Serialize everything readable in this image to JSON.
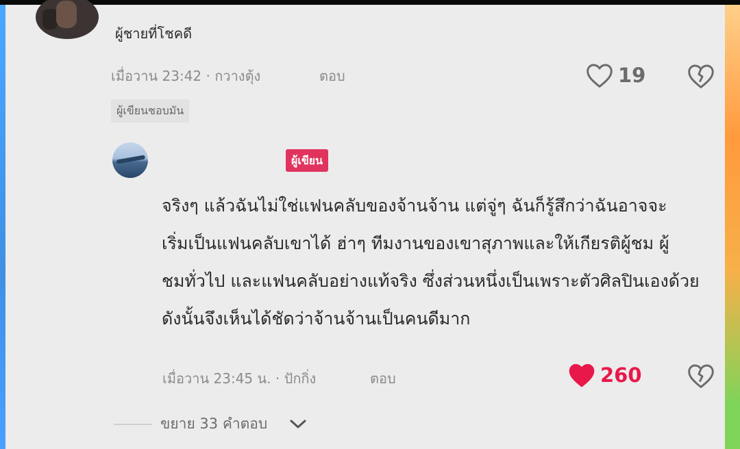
{
  "comment": {
    "username": "ผู้ชายที่โชคดี",
    "meta": "เมื่อวาน 23:42 · กวางตุ้ง",
    "reply_label": "ตอบ",
    "like_count": "19",
    "author_liked_label": "ผู้เขียนชอบมัน"
  },
  "reply": {
    "author_badge": "ผู้เขียน",
    "text_lines": [
      "จริงๆ แล้วฉันไม่ใช่แฟนคลับของจ้านจ้าน แต่จู่ๆ ฉันก็รู้สึกว่าฉันอาจจะ",
      "เริ่มเป็นแฟนคลับเขาได้ ฮ่าๆ ทีมงานของเขาสุภาพและให้เกียรติผู้ชม ผู้",
      "ชมทั่วไป และแฟนคลับอย่างแท้จริง ซึ่งส่วนหนึ่งเป็นเพราะตัวศิลปินเองด้วย",
      "ดังนั้นจึงเห็นได้ชัดว่าจ้านจ้านเป็นคนดีมาก"
    ],
    "meta": "เมื่อวาน 23:45 น. · ปักกิ่ง",
    "reply_label": "ตอบ",
    "like_count": "260",
    "liked": true
  },
  "expand": {
    "label": "ขยาย 33 คำตอบ"
  },
  "colors": {
    "like_active": "#e8194a",
    "author_badge_bg": "#e0345e",
    "text_muted": "#8b8b8b"
  },
  "icons": {
    "like": "heart-icon",
    "dislike": "broken-heart-icon",
    "expand": "chevron-down-icon"
  }
}
